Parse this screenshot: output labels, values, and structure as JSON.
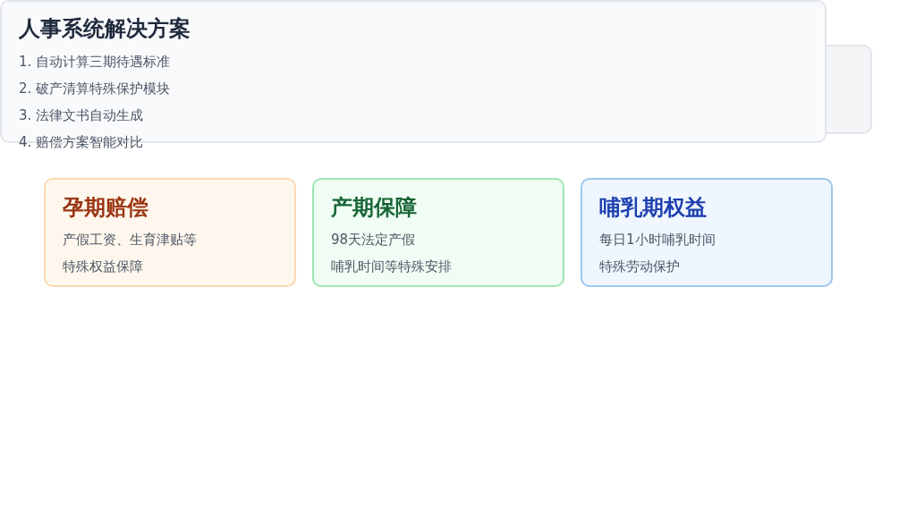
{
  "overlay": {
    "title": "人事系统解决方案",
    "items": [
      "1. 自动计算三期待遇标准",
      "2. 破产清算特殊保护模块",
      "3. 法律文书自动生成",
      "4. 赔偿方案智能对比"
    ]
  },
  "cards": [
    {
      "title": "孕期赔偿",
      "lines": [
        "产假工资、生育津贴等",
        "特殊权益保障"
      ],
      "color": "#9a3412"
    },
    {
      "title": "产期保障",
      "lines": [
        "98天法定产假",
        "哺乳时间等特殊安排"
      ],
      "color": "#166534"
    },
    {
      "title": "哺乳期权益",
      "lines": [
        "每日1小时哺乳时间",
        "特殊劳动保护"
      ],
      "color": "#1e40af"
    }
  ]
}
